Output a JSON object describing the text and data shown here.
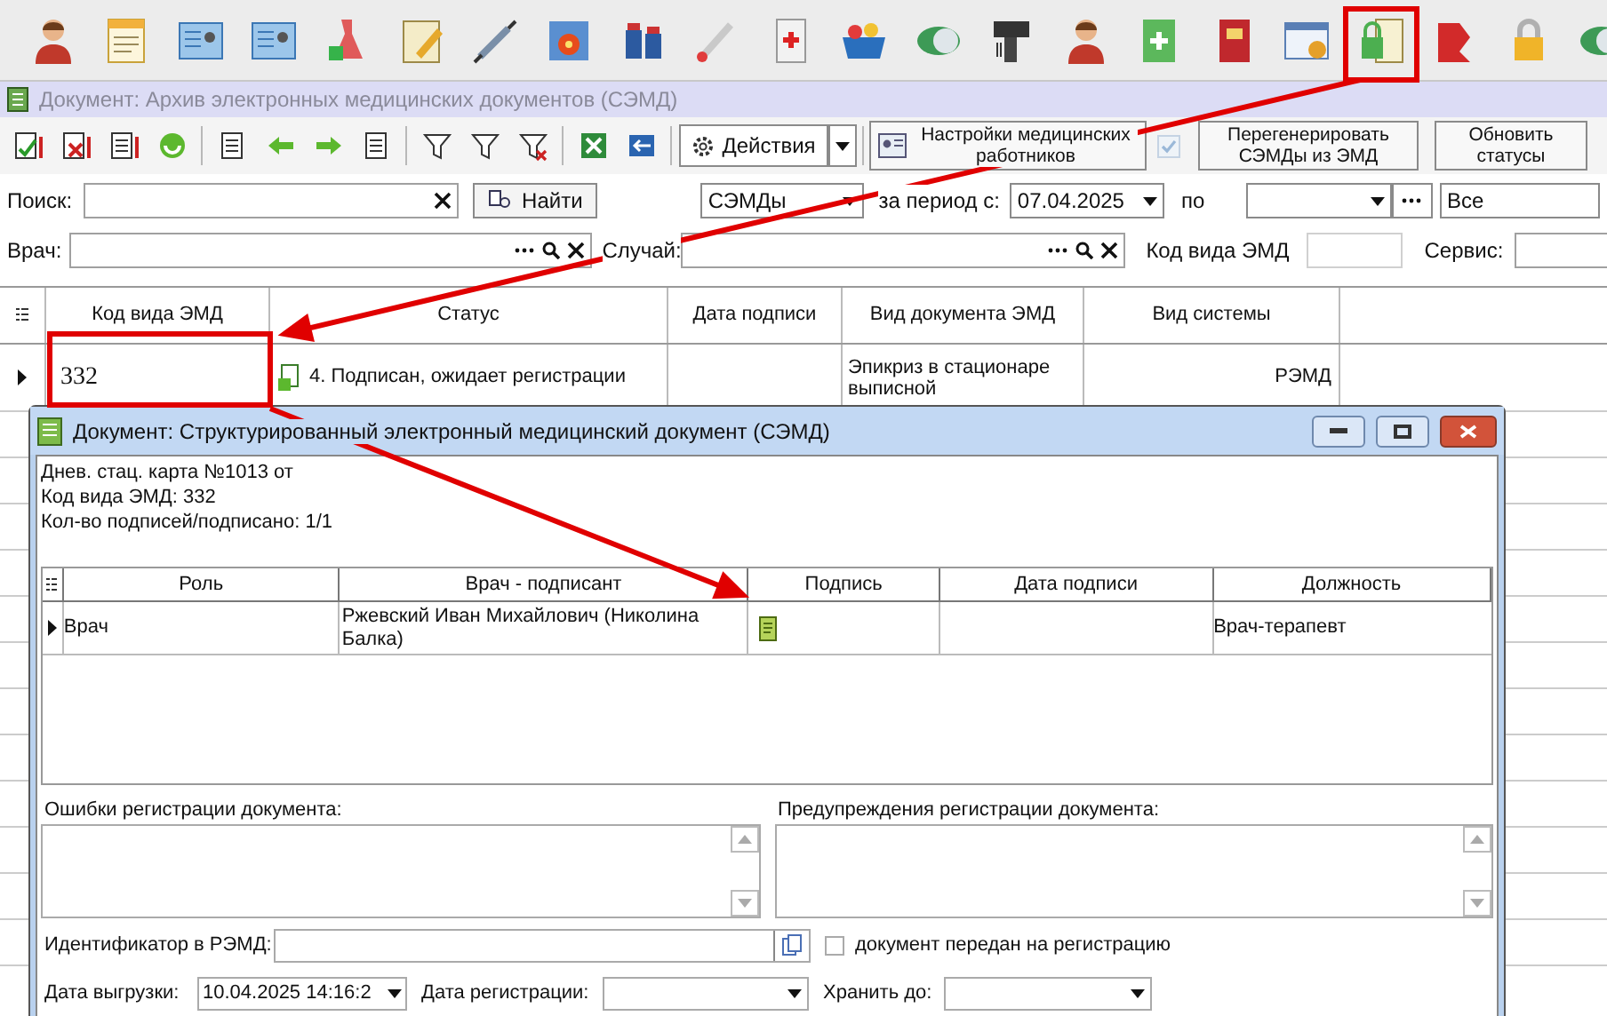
{
  "window": {
    "title": "Документ: Архив электронных медицинских документов (СЭМД)"
  },
  "toolbar": {
    "actions_button": "Действия",
    "settings_button": "Настройки медицинских работников",
    "sync_checkbox": {
      "checked": true,
      "disabled": true
    },
    "regenerate_button": "Перегенерировать СЭМДы из ЭМД",
    "refresh_button": "Обновить статусы"
  },
  "filters": {
    "search_label": "Поиск:",
    "find_button": "Найти",
    "type_select": "СЭМДы",
    "period_label": "за период с:",
    "date_from": "07.04.2025",
    "to_label": "по",
    "scope_select": "Все",
    "doctor_label": "Врач:",
    "case_label": "Случай:",
    "emd_code_label": "Код вида ЭМД",
    "service_label": "Сервис:"
  },
  "table": {
    "columns": [
      "Код вида ЭМД",
      "Статус",
      "Дата подписи",
      "Вид документа ЭМД",
      "Вид системы"
    ],
    "rows": [
      {
        "selected": true,
        "code": "332",
        "status": "4. Подписан, ожидает регистрации",
        "doc_type": "Эпикриз в стационаре выписной",
        "system": "РЭМД"
      }
    ]
  },
  "dialog": {
    "title": "Документ: Структурированный электронный медицинский документ (СЭМД)",
    "info": [
      "Днев. стац. карта №1013 от",
      "Код вида ЭМД: 332",
      "Кол-во подписей/подписано: 1/1"
    ],
    "signers": {
      "columns": [
        "Роль",
        "Врач - подписант",
        "Подпись",
        "Дата подписи",
        "Должность"
      ],
      "rows": [
        {
          "selected": true,
          "role": "Врач",
          "doctor": "Ржевский Иван Михайлович (Николина Балка)",
          "signed": true,
          "position": "Врач-терапевт"
        }
      ]
    },
    "errors_label": "Ошибки регистрации документа:",
    "warnings_label": "Предупреждения регистрации документа:",
    "identifier_label": "Идентификатор в РЭМД:",
    "transferred": {
      "label": "документ передан на регистрацию",
      "checked": false
    },
    "export_date": {
      "label": "Дата выгрузки:",
      "value": "10.04.2025 14:16:2"
    },
    "registration_date": {
      "label": "Дата регистрации:"
    },
    "keep_until": {
      "label": "Хранить до:"
    }
  }
}
